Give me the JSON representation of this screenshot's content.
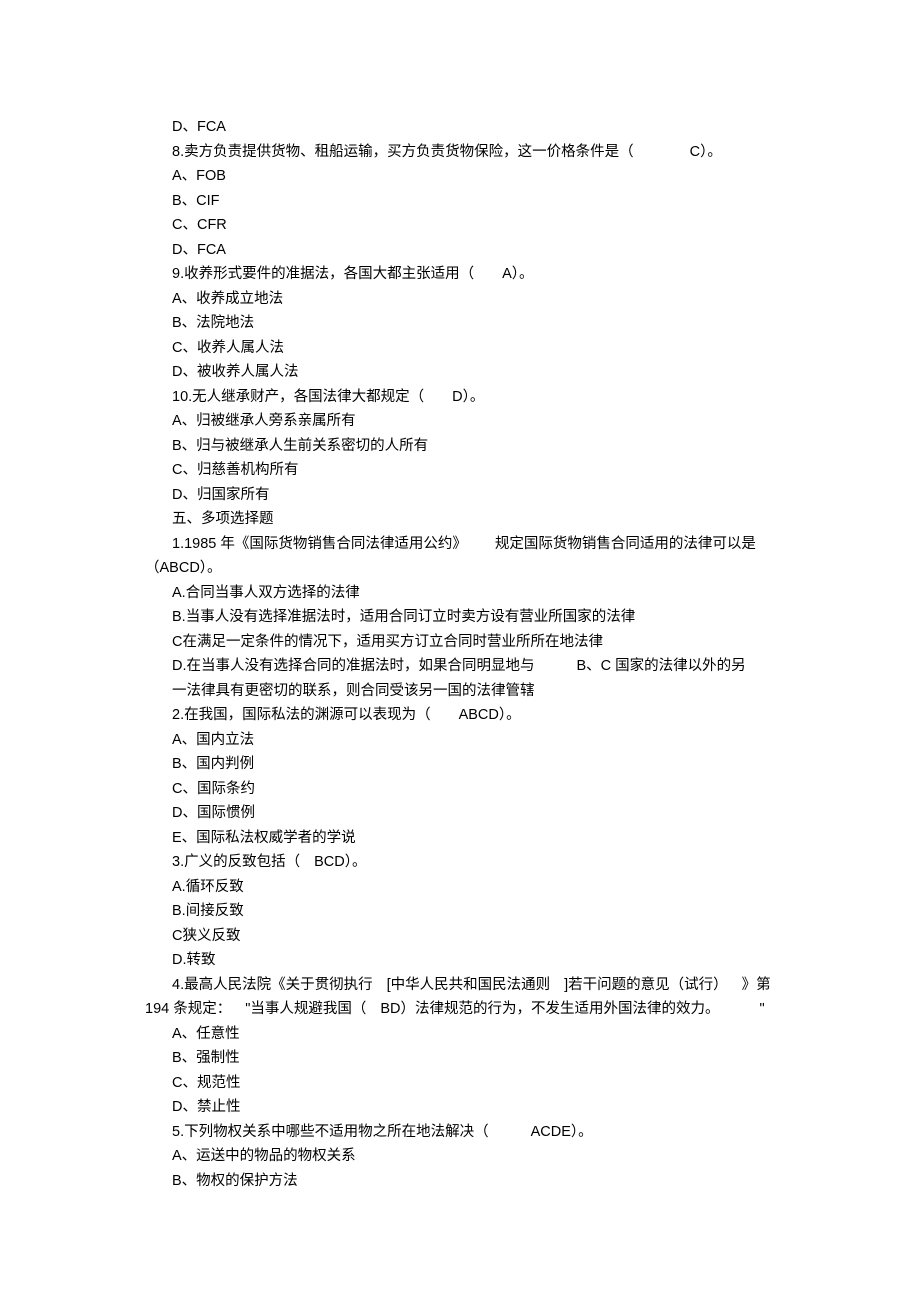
{
  "items": [
    {
      "indent": 0,
      "segments": [
        {
          "t": "D、FCA",
          "c": "latin"
        }
      ]
    },
    {
      "indent": 0,
      "segments": [
        {
          "t": "8.卖方负责提供货物、租船运输，买方负责货物保险，这一价格条件是（"
        },
        {
          "gap": "xl"
        },
        {
          "t": "C）。"
        }
      ]
    },
    {
      "indent": 0,
      "segments": [
        {
          "t": "A、FOB",
          "c": "latin"
        }
      ]
    },
    {
      "indent": 0,
      "segments": [
        {
          "t": "B、CIF",
          "c": "latin"
        }
      ]
    },
    {
      "indent": 0,
      "segments": [
        {
          "t": "C、CFR",
          "c": "latin"
        }
      ]
    },
    {
      "indent": 0,
      "segments": [
        {
          "t": "D、FCA",
          "c": "latin"
        }
      ]
    },
    {
      "indent": 0,
      "segments": [
        {
          "t": "9.收养形式要件的准据法，各国大都主张适用（"
        },
        {
          "gap": "m"
        },
        {
          "t": "A）。"
        }
      ]
    },
    {
      "indent": 0,
      "segments": [
        {
          "t": "A、收养成立地法"
        }
      ]
    },
    {
      "indent": 0,
      "segments": [
        {
          "t": "B、法院地法"
        }
      ]
    },
    {
      "indent": 0,
      "segments": [
        {
          "t": "C、收养人属人法"
        }
      ]
    },
    {
      "indent": 0,
      "segments": [
        {
          "t": "D、被收养人属人法"
        }
      ]
    },
    {
      "indent": 0,
      "segments": [
        {
          "t": "10.无人继承财产，各国法律大都规定（"
        },
        {
          "gap": "m"
        },
        {
          "t": "D）。"
        }
      ]
    },
    {
      "indent": 0,
      "segments": [
        {
          "t": "A、归被继承人旁系亲属所有"
        }
      ]
    },
    {
      "indent": 0,
      "segments": [
        {
          "t": "B、归与被继承人生前关系密切的人所有"
        }
      ]
    },
    {
      "indent": 0,
      "segments": [
        {
          "t": "C、归慈善机构所有"
        }
      ]
    },
    {
      "indent": 0,
      "segments": [
        {
          "t": "D、归国家所有"
        }
      ]
    },
    {
      "indent": 0,
      "segments": [
        {
          "t": "五、多项选择题"
        }
      ]
    },
    {
      "indent": 0,
      "segments": [
        {
          "t": "1.1985 年《国际货物销售合同法律适用公约》"
        },
        {
          "gap": "m"
        },
        {
          "t": "规定国际货物销售合同适用的法律可以是"
        }
      ]
    },
    {
      "indent": -1,
      "segments": [
        {
          "t": "（ABCD）。"
        }
      ]
    },
    {
      "indent": 0,
      "segments": [
        {
          "t": "A.合同当事人双方选择的法律"
        }
      ]
    },
    {
      "indent": 0,
      "segments": [
        {
          "t": "B.当事人没有选择准据法时，适用合同订立时卖方设有营业所国家的法律"
        }
      ]
    },
    {
      "indent": 0,
      "segments": [
        {
          "t": "C在满足一定条件的情况下，适用买方订立合同时营业所所在地法律"
        }
      ]
    },
    {
      "indent": 0,
      "segments": [
        {
          "t": "D.在当事人没有选择合同的准据法时，如果合同明显地与"
        },
        {
          "gap": "l"
        },
        {
          "t": "B、C 国家的法律以外的另"
        }
      ]
    },
    {
      "indent": 0,
      "segments": [
        {
          "t": "一法律具有更密切的联系，则合同受该另一国的法律管辖"
        }
      ]
    },
    {
      "indent": 0,
      "segments": [
        {
          "t": "2.在我国，国际私法的渊源可以表现为（"
        },
        {
          "gap": "m"
        },
        {
          "t": "ABCD）。"
        }
      ]
    },
    {
      "indent": 0,
      "segments": [
        {
          "t": "A、国内立法"
        }
      ]
    },
    {
      "indent": 0,
      "segments": [
        {
          "t": "B、国内判例"
        }
      ]
    },
    {
      "indent": 0,
      "segments": [
        {
          "t": "C、国际条约"
        }
      ]
    },
    {
      "indent": 0,
      "segments": [
        {
          "t": "D、国际惯例"
        }
      ]
    },
    {
      "indent": 0,
      "segments": [
        {
          "t": "E、国际私法权威学者的学说"
        }
      ]
    },
    {
      "indent": 0,
      "segments": [
        {
          "t": "3.广义的反致包括（"
        },
        {
          "gap": "s"
        },
        {
          "t": "BCD）。"
        }
      ]
    },
    {
      "indent": 0,
      "segments": [
        {
          "t": "A.循环反致"
        }
      ]
    },
    {
      "indent": 0,
      "segments": [
        {
          "t": "B.间接反致"
        }
      ]
    },
    {
      "indent": 0,
      "segments": [
        {
          "t": "C狭义反致"
        }
      ]
    },
    {
      "indent": 0,
      "segments": [
        {
          "t": "D.转致"
        }
      ]
    },
    {
      "indent": 0,
      "segments": [
        {
          "t": "4.最高人民法院《关于贯彻执行"
        },
        {
          "gap": "s"
        },
        {
          "t": "[中华人民共和国民法通则"
        },
        {
          "gap": "s"
        },
        {
          "t": "]若干问题的意见（试行）"
        },
        {
          "gap": "s"
        },
        {
          "t": "》第"
        }
      ]
    },
    {
      "indent": -1,
      "segments": [
        {
          "t": "194 条规定："
        },
        {
          "gap": "s"
        },
        {
          "t": "\"当事人规避我国（"
        },
        {
          "gap": "s"
        },
        {
          "t": "BD）法律规范的行为，不发生适用外国法律的效力。"
        },
        {
          "gap": "right"
        },
        {
          "t": "\""
        }
      ]
    },
    {
      "indent": 0,
      "segments": [
        {
          "t": "A、任意性"
        }
      ]
    },
    {
      "indent": 0,
      "segments": [
        {
          "t": "B、强制性"
        }
      ]
    },
    {
      "indent": 0,
      "segments": [
        {
          "t": "C、规范性"
        }
      ]
    },
    {
      "indent": 0,
      "segments": [
        {
          "t": "D、禁止性"
        }
      ]
    },
    {
      "indent": 0,
      "segments": [
        {
          "t": "5.下列物权关系中哪些不适用物之所在地法解决（"
        },
        {
          "gap": "l"
        },
        {
          "t": "ACDE）。"
        }
      ]
    },
    {
      "indent": 0,
      "segments": [
        {
          "t": "A、运送中的物品的物权关系"
        }
      ]
    },
    {
      "indent": 0,
      "segments": [
        {
          "t": "B、物权的保护方法"
        }
      ]
    }
  ]
}
